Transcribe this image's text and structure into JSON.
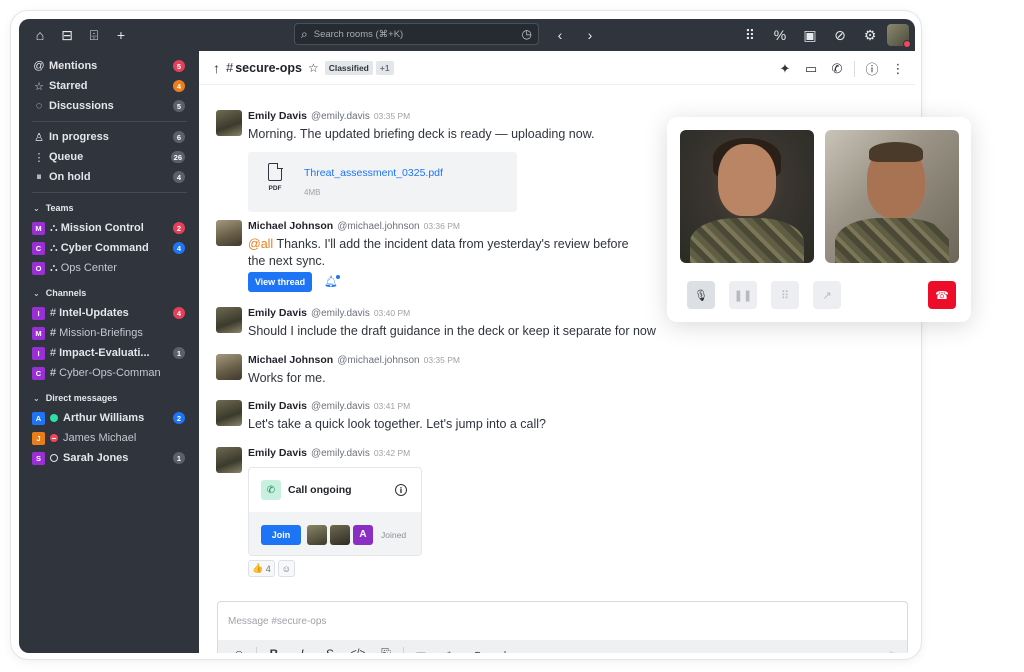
{
  "topbar": {
    "search_placeholder": "Search rooms (⌘+K)"
  },
  "sidebar": {
    "primary": [
      {
        "icon": "@",
        "label": "Mentions",
        "badge": "5",
        "badge_color": "#e5405a"
      },
      {
        "icon": "☆",
        "label": "Starred",
        "badge": "4",
        "badge_color": "#ee7d1f"
      },
      {
        "icon": "◌",
        "label": "Discussions",
        "badge": "5",
        "badge_color": "#5a616c"
      }
    ],
    "queue": [
      {
        "label": "In progress",
        "badge": "6"
      },
      {
        "label": "Queue",
        "badge": "26"
      },
      {
        "label": "On hold",
        "badge": "4"
      }
    ],
    "teams_header": "Teams",
    "teams": [
      {
        "avatar": "M",
        "label": "Mission Control",
        "badge": "2",
        "badge_color": "#e5405a"
      },
      {
        "avatar": "C",
        "label": "Cyber Command",
        "badge": "4",
        "badge_color": "#1d74f5"
      },
      {
        "avatar": "O",
        "label": "Ops Center"
      }
    ],
    "channels_header": "Channels",
    "channels": [
      {
        "avatar": "I",
        "label": "Intel-Updates",
        "badge": "4",
        "badge_color": "#e5405a"
      },
      {
        "avatar": "M",
        "label": "Mission-Briefings"
      },
      {
        "avatar": "I",
        "label": "Impact-Evaluati...",
        "badge": "1"
      },
      {
        "avatar": "C",
        "label": "Cyber-Ops-Comman"
      }
    ],
    "dm_header": "Direct messages",
    "dms": [
      {
        "avatar": "A",
        "avatar_color": "#1d74f5",
        "label": "Arthur Williams",
        "status_color": "#2de0a5",
        "badge": "2",
        "badge_color": "#1d74f5"
      },
      {
        "avatar": "J",
        "avatar_color": "#e87d1a",
        "label": "James Michael",
        "status_color": "#f5455c"
      },
      {
        "avatar": "S",
        "avatar_color": "#9b2fd6",
        "label": "Sarah Jones",
        "status": "offline",
        "badge": "1"
      }
    ]
  },
  "room": {
    "name": "secure-ops",
    "tag": "Classified",
    "tag_extra": "+1"
  },
  "messages": [
    {
      "name": "Emily Davis",
      "handle": "@emily.davis",
      "time": "03:35 PM",
      "text": "Morning. The updated briefing deck is ready — uploading now."
    },
    {
      "name": "Michael Johnson",
      "handle": "@michael.johnson",
      "time": "03:36 PM",
      "mention": "@all",
      "text": " Thanks. I'll add the incident data from yesterday's review before",
      "text2": "the next sync."
    },
    {
      "name": "Emily Davis",
      "handle": "@emily.davis",
      "time": "03:40 PM",
      "text": "Should I include the draft guidance in the deck or keep it separate for now"
    },
    {
      "name": "Michael Johnson",
      "handle": "@michael.johnson",
      "time": "03:35 PM",
      "text": "Works for me."
    },
    {
      "name": "Emily Davis",
      "handle": "@emily.davis",
      "time": "03:41 PM",
      "text": "Let's take a quick look together. Let's jump into a call?"
    },
    {
      "name": "Emily Davis",
      "handle": "@emily.davis",
      "time": "03:42 PM"
    }
  ],
  "file": {
    "name": "Threat_assessment_0325.pdf",
    "ext": "PDF",
    "size": "4MB"
  },
  "thread_button": "View thread",
  "call_card": {
    "title": "Call ongoing",
    "join": "Join",
    "joined": "Joined",
    "participant_initial": "A"
  },
  "reaction": {
    "emoji": "👍",
    "count": "4"
  },
  "composer": {
    "placeholder": "Message #secure-ops"
  }
}
